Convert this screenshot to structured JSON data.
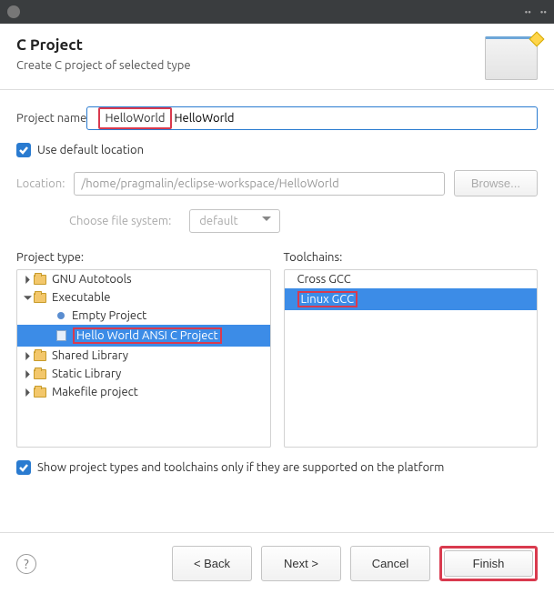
{
  "titlebar": {
    "icon_name": "eclipse-icon"
  },
  "header": {
    "title": "C Project",
    "subtitle": "Create C project of selected type"
  },
  "project_name": {
    "label": "Project name:",
    "value": "HelloWorld"
  },
  "use_default_location": {
    "label": "Use default location",
    "checked": true
  },
  "location": {
    "label": "Location:",
    "value": "/home/pragmalin/eclipse-workspace/HelloWorld",
    "browse": "Browse..."
  },
  "filesystem": {
    "label": "Choose file system:",
    "value": "default"
  },
  "project_type": {
    "label": "Project type:",
    "items": [
      {
        "name": "GNU Autotools",
        "expanded": false,
        "icon": "folder",
        "level": 0
      },
      {
        "name": "Executable",
        "expanded": true,
        "icon": "folder",
        "level": 0
      },
      {
        "name": "Empty Project",
        "icon": "bullet",
        "level": 1
      },
      {
        "name": "Hello World ANSI C Project",
        "icon": "file",
        "level": 1,
        "selected": true,
        "highlighted": true
      },
      {
        "name": "Shared Library",
        "expanded": false,
        "icon": "folder",
        "level": 0
      },
      {
        "name": "Static Library",
        "expanded": false,
        "icon": "folder",
        "level": 0
      },
      {
        "name": "Makefile project",
        "expanded": false,
        "icon": "folder",
        "level": 0
      }
    ]
  },
  "toolchains": {
    "label": "Toolchains:",
    "items": [
      {
        "name": "Cross GCC",
        "selected": false
      },
      {
        "name": "Linux GCC",
        "selected": true,
        "highlighted": true
      }
    ]
  },
  "supported_checkbox": {
    "label": "Show project types and toolchains only if they are supported on the platform",
    "checked": true
  },
  "buttons": {
    "back": "< Back",
    "next": "Next >",
    "cancel": "Cancel",
    "finish": "Finish"
  }
}
